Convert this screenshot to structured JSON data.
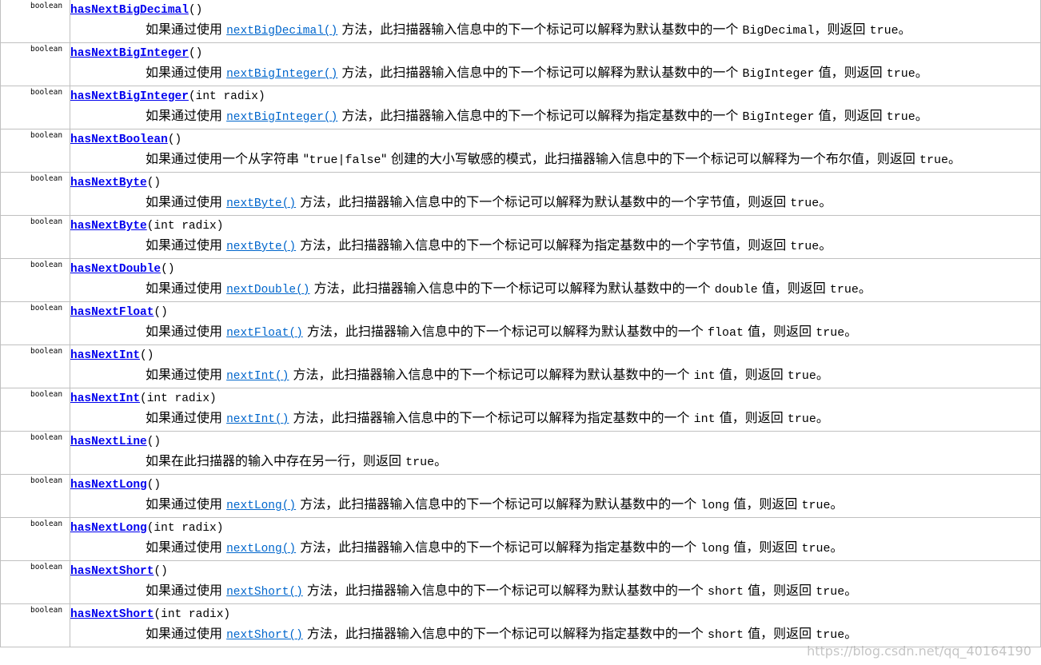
{
  "rows": [
    {
      "type": "boolean",
      "method": "hasNextBigDecimal",
      "params": "()",
      "segments": [
        {
          "t": "如果通过使用 "
        },
        {
          "link": "nextBigDecimal()"
        },
        {
          "t": " 方法，此扫描器输入信息中的下一个标记可以解释为默认基数中的一个 "
        },
        {
          "code": "BigDecimal"
        },
        {
          "t": "，则返回 "
        },
        {
          "code": "true"
        },
        {
          "t": "。"
        }
      ]
    },
    {
      "type": "boolean",
      "method": "hasNextBigInteger",
      "params": "()",
      "segments": [
        {
          "t": "如果通过使用 "
        },
        {
          "link": "nextBigInteger()"
        },
        {
          "t": " 方法，此扫描器输入信息中的下一个标记可以解释为默认基数中的一个 "
        },
        {
          "code": "BigInteger"
        },
        {
          "t": " 值，则返回 "
        },
        {
          "code": "true"
        },
        {
          "t": "。"
        }
      ]
    },
    {
      "type": "boolean",
      "method": "hasNextBigInteger",
      "params": "(int radix)",
      "segments": [
        {
          "t": "如果通过使用 "
        },
        {
          "link": "nextBigInteger()"
        },
        {
          "t": " 方法，此扫描器输入信息中的下一个标记可以解释为指定基数中的一个 "
        },
        {
          "code": "BigInteger"
        },
        {
          "t": " 值，则返回 "
        },
        {
          "code": "true"
        },
        {
          "t": "。"
        }
      ]
    },
    {
      "type": "boolean",
      "method": "hasNextBoolean",
      "params": "()",
      "segments": [
        {
          "t": "如果通过使用一个从字符串 \""
        },
        {
          "code": "true|false"
        },
        {
          "t": "\" 创建的大小写敏感的模式，此扫描器输入信息中的下一个标记可以解释为一个布尔值，则返回 "
        },
        {
          "code": "true"
        },
        {
          "t": "。"
        }
      ]
    },
    {
      "type": "boolean",
      "method": "hasNextByte",
      "params": "()",
      "segments": [
        {
          "t": "如果通过使用 "
        },
        {
          "link": "nextByte()"
        },
        {
          "t": " 方法，此扫描器输入信息中的下一个标记可以解释为默认基数中的一个字节值，则返回 "
        },
        {
          "code": "true"
        },
        {
          "t": "。"
        }
      ]
    },
    {
      "type": "boolean",
      "method": "hasNextByte",
      "params": "(int radix)",
      "segments": [
        {
          "t": "如果通过使用 "
        },
        {
          "link": "nextByte()"
        },
        {
          "t": " 方法，此扫描器输入信息中的下一个标记可以解释为指定基数中的一个字节值，则返回 "
        },
        {
          "code": "true"
        },
        {
          "t": "。"
        }
      ]
    },
    {
      "type": "boolean",
      "method": "hasNextDouble",
      "params": "()",
      "segments": [
        {
          "t": "如果通过使用 "
        },
        {
          "link": "nextDouble()"
        },
        {
          "t": " 方法，此扫描器输入信息中的下一个标记可以解释为默认基数中的一个 "
        },
        {
          "code": "double"
        },
        {
          "t": " 值，则返回 "
        },
        {
          "code": "true"
        },
        {
          "t": "。"
        }
      ]
    },
    {
      "type": "boolean",
      "method": "hasNextFloat",
      "params": "()",
      "segments": [
        {
          "t": "如果通过使用 "
        },
        {
          "link": "nextFloat()"
        },
        {
          "t": " 方法，此扫描器输入信息中的下一个标记可以解释为默认基数中的一个 "
        },
        {
          "code": "float"
        },
        {
          "t": " 值，则返回 "
        },
        {
          "code": "true"
        },
        {
          "t": "。"
        }
      ]
    },
    {
      "type": "boolean",
      "method": "hasNextInt",
      "params": "()",
      "segments": [
        {
          "t": "如果通过使用 "
        },
        {
          "link": "nextInt()"
        },
        {
          "t": " 方法，此扫描器输入信息中的下一个标记可以解释为默认基数中的一个 "
        },
        {
          "code": "int"
        },
        {
          "t": " 值，则返回 "
        },
        {
          "code": "true"
        },
        {
          "t": "。"
        }
      ]
    },
    {
      "type": "boolean",
      "method": "hasNextInt",
      "params": "(int radix)",
      "segments": [
        {
          "t": "如果通过使用 "
        },
        {
          "link": "nextInt()"
        },
        {
          "t": " 方法，此扫描器输入信息中的下一个标记可以解释为指定基数中的一个 "
        },
        {
          "code": "int"
        },
        {
          "t": " 值，则返回 "
        },
        {
          "code": "true"
        },
        {
          "t": "。"
        }
      ]
    },
    {
      "type": "boolean",
      "method": "hasNextLine",
      "params": "()",
      "segments": [
        {
          "t": "如果在此扫描器的输入中存在另一行，则返回 "
        },
        {
          "code": "true"
        },
        {
          "t": "。"
        }
      ]
    },
    {
      "type": "boolean",
      "method": "hasNextLong",
      "params": "()",
      "segments": [
        {
          "t": "如果通过使用 "
        },
        {
          "link": "nextLong()"
        },
        {
          "t": " 方法，此扫描器输入信息中的下一个标记可以解释为默认基数中的一个 "
        },
        {
          "code": "long"
        },
        {
          "t": " 值，则返回 "
        },
        {
          "code": "true"
        },
        {
          "t": "。"
        }
      ]
    },
    {
      "type": "boolean",
      "method": "hasNextLong",
      "params": "(int radix)",
      "segments": [
        {
          "t": "如果通过使用 "
        },
        {
          "link": "nextLong()"
        },
        {
          "t": " 方法，此扫描器输入信息中的下一个标记可以解释为指定基数中的一个 "
        },
        {
          "code": "long"
        },
        {
          "t": " 值，则返回 "
        },
        {
          "code": "true"
        },
        {
          "t": "。"
        }
      ]
    },
    {
      "type": "boolean",
      "method": "hasNextShort",
      "params": "()",
      "segments": [
        {
          "t": "如果通过使用 "
        },
        {
          "link": "nextShort()"
        },
        {
          "t": " 方法，此扫描器输入信息中的下一个标记可以解释为默认基数中的一个 "
        },
        {
          "code": "short"
        },
        {
          "t": " 值，则返回 "
        },
        {
          "code": "true"
        },
        {
          "t": "。"
        }
      ]
    },
    {
      "type": "boolean",
      "method": "hasNextShort",
      "params": "(int radix)",
      "segments": [
        {
          "t": "如果通过使用 "
        },
        {
          "link": "nextShort()"
        },
        {
          "t": " 方法，此扫描器输入信息中的下一个标记可以解释为指定基数中的一个 "
        },
        {
          "code": "short"
        },
        {
          "t": " 值，则返回 "
        },
        {
          "code": "true"
        },
        {
          "t": "。"
        }
      ]
    }
  ],
  "watermark": "https://blog.csdn.net/qq_40164190",
  "colors": {
    "method_link": "#0000ee",
    "inline_link": "#0066cc",
    "border": "#c0c0c0"
  }
}
